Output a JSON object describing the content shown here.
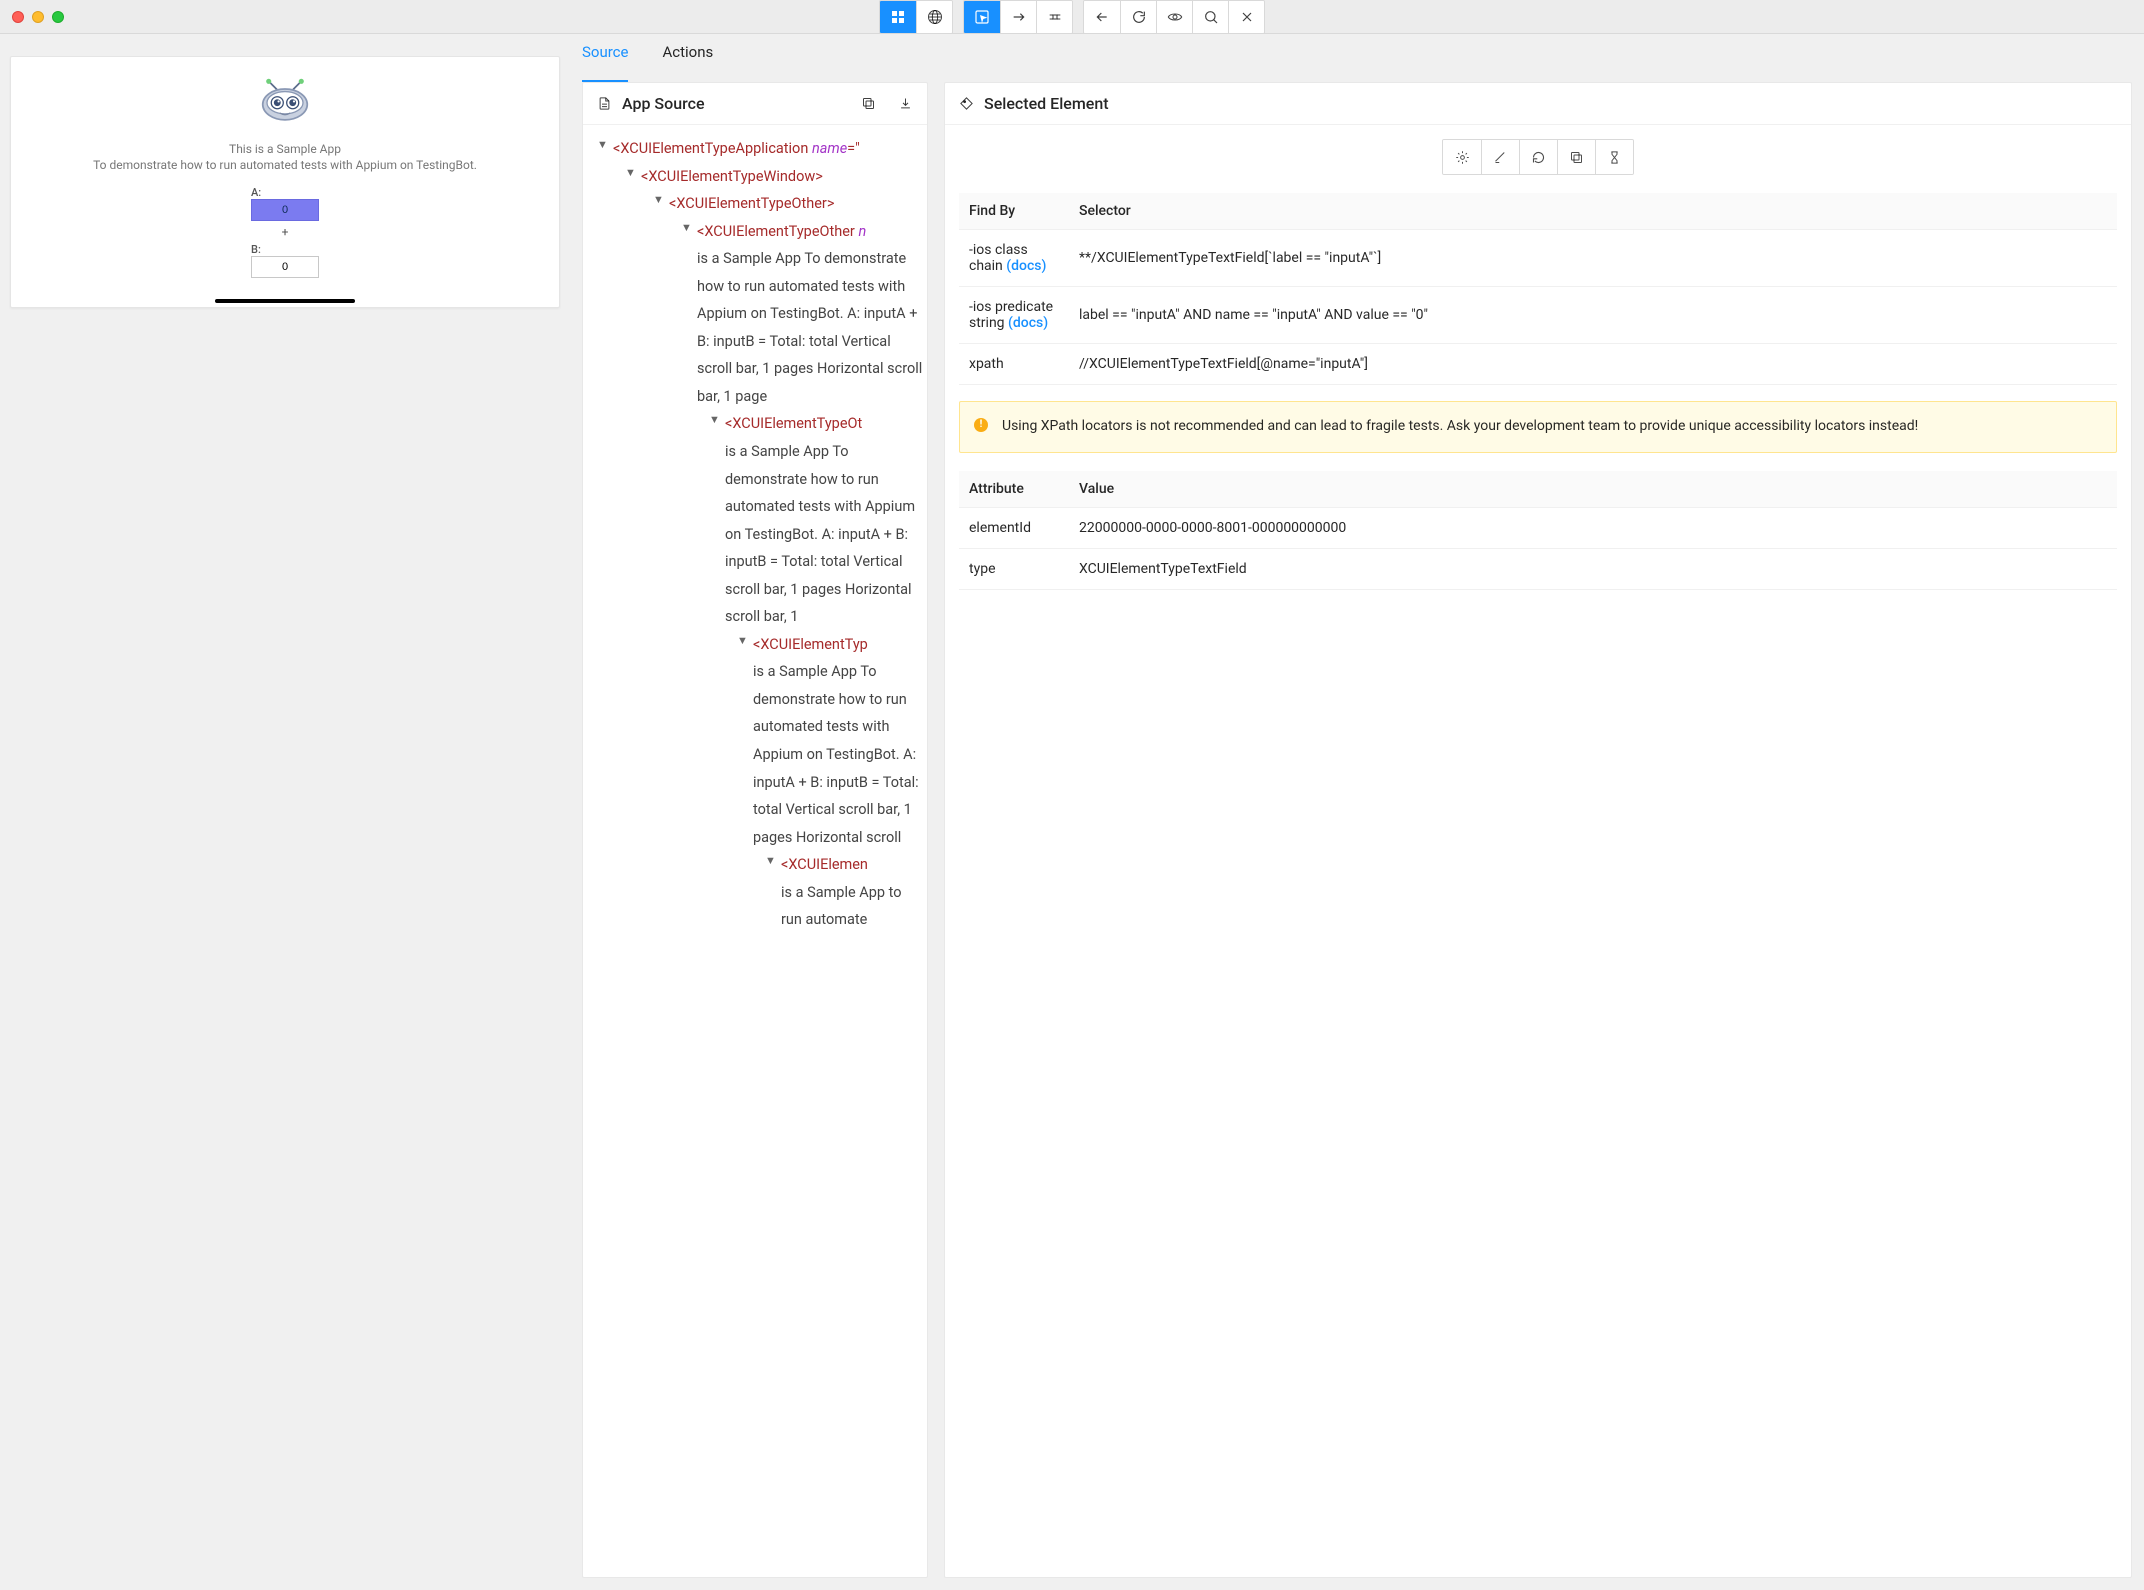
{
  "tabs": {
    "source": "Source",
    "actions": "Actions"
  },
  "source_panel": {
    "title": "App Source",
    "tree": {
      "app_tag": "XCUIElementTypeApplication",
      "app_attr": "name",
      "app_attr_eq": "=\"",
      "window_tag": "XCUIElementTypeWindow",
      "other_tag": "XCUIElementTypeOther",
      "other_attr_prefix": "n",
      "node_text_1": "is a Sample App To demonstrate how to run automated tests with Appium on TestingBot. A: inputA + B: inputB = Total: total Vertical scroll bar, 1 pages Horizontal scroll bar, 1 page",
      "node_text_2": "is a Sample App To demonstrate how to run automated tests with Appium on TestingBot. A: inputA + B: inputB = Total: total Vertical scroll bar, 1 pages Horizontal scroll bar, 1",
      "node_text_3": "is a Sample App To demonstrate how to run automated tests with Appium on TestingBot. A: inputA + B: inputB = Total: total Vertical scroll bar, 1 pages Horizontal scroll",
      "deep_tag": "XCUIElementType",
      "node_text_4": "is a Sample App to run automate"
    }
  },
  "selected_panel": {
    "title": "Selected Element",
    "table1": {
      "h1": "Find By",
      "h2": "Selector",
      "rows": [
        {
          "k": "-ios class chain",
          "docs": "(docs)",
          "v": "**/XCUIElementTypeTextField[`label == \"inputA\"`]"
        },
        {
          "k": "-ios predicate string",
          "docs": "(docs)",
          "v": "label == \"inputA\" AND name == \"inputA\" AND value == \"0\""
        },
        {
          "k": "xpath",
          "docs": "",
          "v": "//XCUIElementTypeTextField[@name=\"inputA\"]"
        }
      ]
    },
    "warning": "Using XPath locators is not recommended and can lead to fragile tests. Ask your development team to provide unique accessibility locators instead!",
    "table2": {
      "h1": "Attribute",
      "h2": "Value",
      "rows": [
        {
          "k": "elementId",
          "v": "22000000-0000-0000-8001-000000000000"
        },
        {
          "k": "type",
          "v": "XCUIElementTypeTextField"
        }
      ]
    }
  },
  "device": {
    "title": "This is a Sample App",
    "subtitle": "To demonstrate how to run automated tests with Appium on TestingBot.",
    "labelA": "A:",
    "valueA": "0",
    "plus": "+",
    "labelB": "B:",
    "valueB": "0"
  }
}
